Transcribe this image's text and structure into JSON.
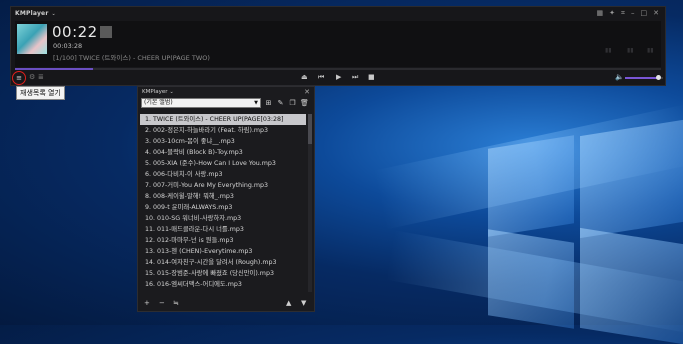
{
  "player": {
    "brand": "KMPlayer",
    "time": "00:22",
    "duration": "00:03:28",
    "track_line": "[1/100] TWICE (트와이스) - CHEER UP(PAGE TWO)",
    "seek_progress": 0.12,
    "volume_level": 0.88,
    "accent_color": "#6b4fc2"
  },
  "tooltip": "재생목록 열기",
  "playlist": {
    "brand": "KMPlayer",
    "list_name": "(기본 앨범)",
    "items": [
      "1. TWICE (트와이스) - CHEER UP(PAGE[03:28]",
      "2. 002-정은지-하늘바라기 (Feat. 하림).mp3",
      "3. 003-10cm-봄이 좋냐__.mp3",
      "4. 004-블락비 (Block B)-Toy.mp3",
      "5. 005-XIA (준수)-How Can I Love You.mp3",
      "6. 006-다비치-이 사랑.mp3",
      "7. 007-거미-You Are My Everything.mp3",
      "8. 008-케이윌-말해! 뭐해_.mp3",
      "9. 009-t 윤미래-ALWAYS.mp3",
      "10. 010-SG 워너비-사랑하자.mp3",
      "11. 011-매드클라운-다시 너를.mp3",
      "12. 012-마마무-넌 is 뭔들.mp3",
      "13. 013-첸 (CHEN)-Everytime.mp3",
      "14. 014-여자친구-시간을 달려서 (Rough).mp3",
      "15. 015-장범준-사랑에 빠졌죠 (당신만이).mp3",
      "16. 016-엠씨더맥스-어디에도.mp3"
    ]
  }
}
